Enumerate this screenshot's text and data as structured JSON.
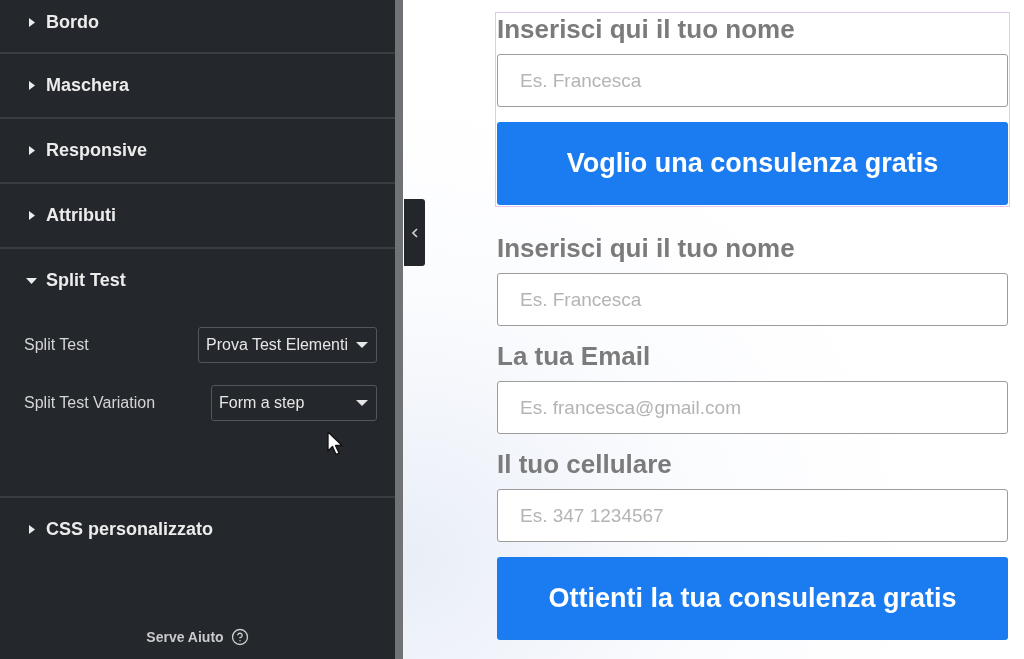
{
  "sidebar": {
    "sections": [
      {
        "title": "Bordo",
        "expanded": false
      },
      {
        "title": "Maschera",
        "expanded": false
      },
      {
        "title": "Responsive",
        "expanded": false
      },
      {
        "title": "Attributi",
        "expanded": false
      },
      {
        "title": "Split Test",
        "expanded": true,
        "fields": [
          {
            "label": "Split Test",
            "value": "Prova Test Elementi"
          },
          {
            "label": "Split Test Variation",
            "value": "Form a step"
          }
        ]
      },
      {
        "title": "CSS personalizzato",
        "expanded": false
      }
    ],
    "help_link": "Serve Aiuto"
  },
  "preview": {
    "forms": [
      {
        "selected": true,
        "fields": [
          {
            "label": "Inserisci qui il tuo nome",
            "placeholder": "Es. Francesca"
          }
        ],
        "submit": "Voglio una consulenza gratis"
      },
      {
        "selected": false,
        "fields": [
          {
            "label": "Inserisci qui il tuo nome",
            "placeholder": "Es. Francesca"
          },
          {
            "label": "La tua Email",
            "placeholder": "Es. francesca@gmail.com"
          },
          {
            "label": "Il tuo cellulare",
            "placeholder": "Es. 347 1234567"
          }
        ],
        "submit": "Ottienti la tua consulenza gratis"
      }
    ]
  }
}
